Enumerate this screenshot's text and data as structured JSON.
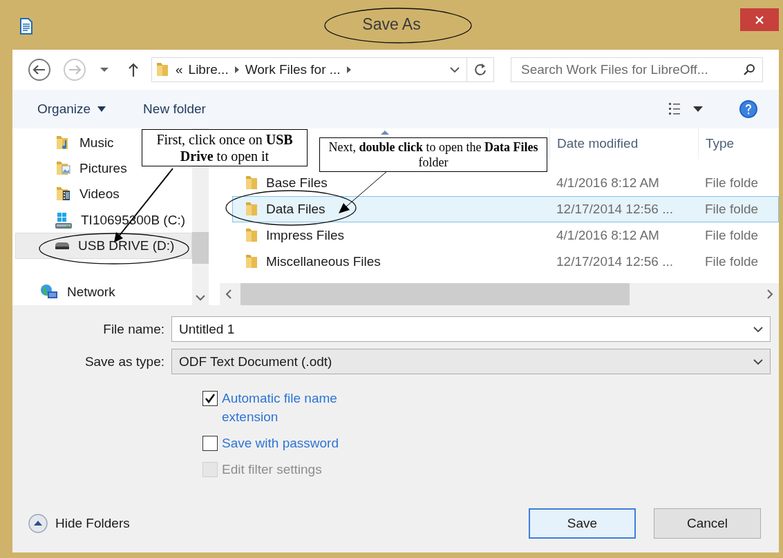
{
  "window": {
    "title": "Save As"
  },
  "address_bar": {
    "overflow_marker": "«",
    "path": [
      "Libre...",
      "Work Files for ..."
    ]
  },
  "search": {
    "placeholder": "Search Work Files for LibreOff..."
  },
  "command_bar": {
    "organize": "Organize",
    "new_folder": "New folder"
  },
  "nav_items": [
    {
      "label": "Music",
      "kind": "music",
      "selected": false
    },
    {
      "label": "Pictures",
      "kind": "pictures",
      "selected": false
    },
    {
      "label": "Videos",
      "kind": "videos",
      "selected": false
    },
    {
      "label": "TI10695300B (C:)",
      "kind": "system-drive",
      "selected": false
    },
    {
      "label": "USB DRIVE (D:)",
      "kind": "usb-drive",
      "selected": true
    },
    {
      "label": "Network",
      "kind": "network",
      "selected": false
    }
  ],
  "file_list": {
    "columns": [
      "Date modified",
      "Type"
    ],
    "rows": [
      {
        "name": "Base Files",
        "date": "4/1/2016 8:12 AM",
        "type": "File folde",
        "selected": false
      },
      {
        "name": "Data Files",
        "date": "12/17/2014 12:56 ...",
        "type": "File folde",
        "selected": true
      },
      {
        "name": "Impress Files",
        "date": "4/1/2016 8:12 AM",
        "type": "File folde",
        "selected": false
      },
      {
        "name": "Miscellaneous Files",
        "date": "12/17/2014 12:56 ...",
        "type": "File folde",
        "selected": false
      }
    ]
  },
  "form": {
    "file_name_label": "File name:",
    "file_name": "Untitled 1",
    "type_label": "Save as type:",
    "type_value": "ODF Text Document (.odt)"
  },
  "options": [
    {
      "label": "Automatic file name extension",
      "checked": true,
      "disabled": false
    },
    {
      "label": "Save with password",
      "checked": false,
      "disabled": false
    },
    {
      "label": "Edit filter settings",
      "checked": false,
      "disabled": true
    }
  ],
  "hide_folders": "Hide Folders",
  "buttons": [
    {
      "label": "Save",
      "default": true
    },
    {
      "label": "Cancel",
      "default": false
    }
  ],
  "annotations": [
    {
      "kind": "callout",
      "text": "First, click once on **USB Drive** to open it"
    },
    {
      "kind": "callout",
      "text": "Next, **double click** to open the **Data Files** folder"
    }
  ]
}
